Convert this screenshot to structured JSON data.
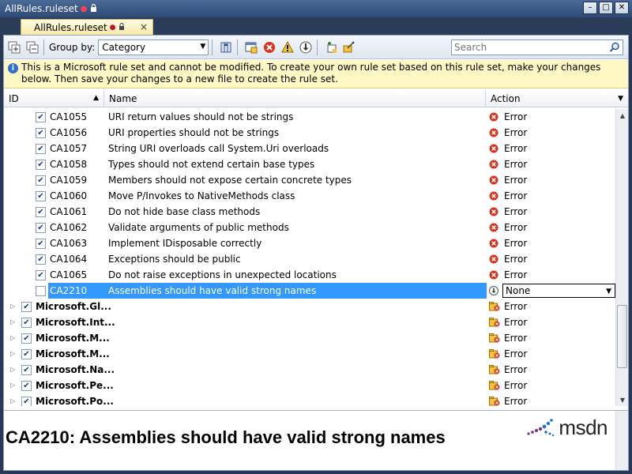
{
  "window": {
    "title": "AllRules.ruleset",
    "modified_mark": "●",
    "minimize": "–",
    "maximize": "□",
    "close": "✕"
  },
  "tab": {
    "label": "AllRules.ruleset",
    "modified_mark": "●",
    "close": "×"
  },
  "toolbar": {
    "group_by_label": "Group by:",
    "group_by_value": "Category",
    "search_placeholder": "Search",
    "icons": [
      "expand-all-icon",
      "collapse-all-icon",
      "column-options-icon",
      "filter-icon",
      "error-filter-icon",
      "warning-filter-icon",
      "none-filter-icon",
      "add-ruleset-icon",
      "properties-icon"
    ]
  },
  "infobar": {
    "text": "This is a Microsoft rule set and cannot be modified. To create your own rule set based on this rule set, make your changes below. Then save your changes to a new file to create the rule set."
  },
  "grid": {
    "columns": [
      {
        "label": "ID"
      },
      {
        "label": "Name"
      },
      {
        "label": "Action"
      }
    ],
    "rules": [
      {
        "id": "CA1055",
        "name": "URI return values should not be strings",
        "checked": true,
        "action": "Error"
      },
      {
        "id": "CA1056",
        "name": "URI properties should not be strings",
        "checked": true,
        "action": "Error"
      },
      {
        "id": "CA1057",
        "name": "String URI overloads call System.Uri overloads",
        "checked": true,
        "action": "Error"
      },
      {
        "id": "CA1058",
        "name": "Types should not extend certain base types",
        "checked": true,
        "action": "Error"
      },
      {
        "id": "CA1059",
        "name": "Members should not expose certain concrete types",
        "checked": true,
        "action": "Error"
      },
      {
        "id": "CA1060",
        "name": "Move P/Invokes to NativeMethods class",
        "checked": true,
        "action": "Error"
      },
      {
        "id": "CA1061",
        "name": "Do not hide base class methods",
        "checked": true,
        "action": "Error"
      },
      {
        "id": "CA1062",
        "name": "Validate arguments of public methods",
        "checked": true,
        "action": "Error"
      },
      {
        "id": "CA1063",
        "name": "Implement IDisposable correctly",
        "checked": true,
        "action": "Error"
      },
      {
        "id": "CA1064",
        "name": "Exceptions should be public",
        "checked": true,
        "action": "Error"
      },
      {
        "id": "CA1065",
        "name": "Do not raise exceptions in unexpected locations",
        "checked": true,
        "action": "Error"
      },
      {
        "id": "CA2210",
        "name": "Assemblies should have valid strong names",
        "checked": false,
        "action": "None",
        "selected": true
      }
    ],
    "groups": [
      {
        "name": "Microsoft.Gl...",
        "checked": true,
        "action": "Error"
      },
      {
        "name": "Microsoft.Int...",
        "checked": true,
        "action": "Error"
      },
      {
        "name": "Microsoft.M...",
        "checked": true,
        "action": "Error"
      },
      {
        "name": "Microsoft.M...",
        "checked": true,
        "action": "Error"
      },
      {
        "name": "Microsoft.Na...",
        "checked": true,
        "action": "Error"
      },
      {
        "name": "Microsoft.Pe...",
        "checked": true,
        "action": "Error"
      },
      {
        "name": "Microsoft.Po...",
        "checked": true,
        "action": "Error"
      }
    ]
  },
  "help": {
    "title": "CA2210: Assemblies should have valid strong names",
    "logo_text": "msdn"
  },
  "colors": {
    "selection": "#3399ff",
    "error": "#d9341c",
    "infobar": "#fff8c4"
  }
}
